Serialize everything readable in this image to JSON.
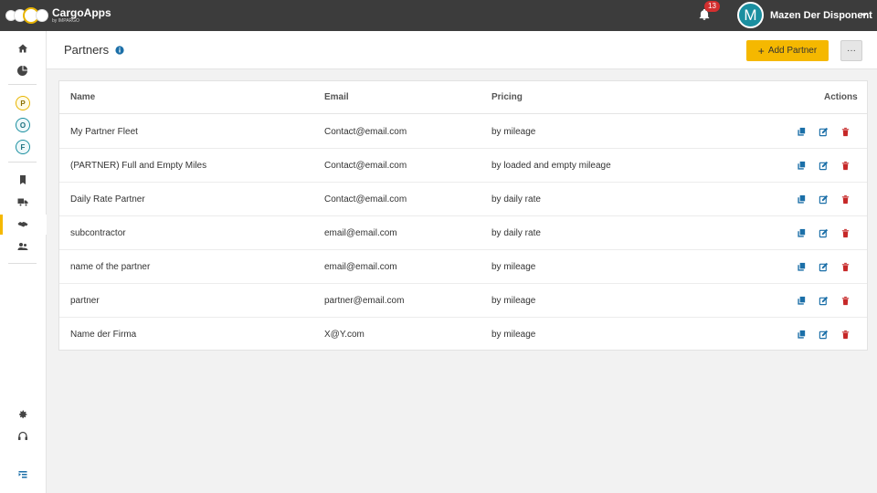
{
  "app": {
    "name": "CargoApps",
    "subtitle": "by IMPARGO"
  },
  "topbar": {
    "notification_count": "13",
    "avatar_initial": "M",
    "user_name": "Mazen Der Disponent"
  },
  "sidebar": {
    "letters": [
      "P",
      "O",
      "F"
    ],
    "icons": [
      "home-icon",
      "chart-pie-icon",
      "bookmark-icon",
      "truck-icon",
      "handshake-icon",
      "users-icon",
      "settings-icon",
      "support-icon",
      "collapse-icon"
    ],
    "active_item": "handshake-icon",
    "letter_colors": {
      "P": "#e8b400",
      "O": "#1a8fa0",
      "F": "#1a8fa0"
    }
  },
  "page": {
    "title": "Partners",
    "add_button": "Add Partner",
    "more_button": "···"
  },
  "table": {
    "headers": {
      "name": "Name",
      "email": "Email",
      "pricing": "Pricing",
      "actions": "Actions"
    },
    "rows": [
      {
        "name": "My Partner Fleet",
        "email": "Contact@email.com",
        "pricing": "by mileage"
      },
      {
        "name": "(PARTNER) Full and Empty Miles",
        "email": "Contact@email.com",
        "pricing": "by loaded and empty mileage"
      },
      {
        "name": "Daily Rate Partner",
        "email": "Contact@email.com",
        "pricing": "by daily rate"
      },
      {
        "name": "subcontractor",
        "email": "email@email.com",
        "pricing": "by daily rate"
      },
      {
        "name": "name of the partner",
        "email": "email@email.com",
        "pricing": "by mileage"
      },
      {
        "name": "partner",
        "email": "partner@email.com",
        "pricing": "by mileage"
      },
      {
        "name": "Name der Firma",
        "email": "X@Y.com",
        "pricing": "by mileage"
      }
    ],
    "action_icons": [
      "copy-icon",
      "edit-icon",
      "delete-icon"
    ]
  },
  "colors": {
    "topbar": "#3c3c3c",
    "accent": "#f5b800",
    "action_blue": "#1b6fa8",
    "delete_red": "#c62828",
    "avatar": "#1a8fa0"
  }
}
